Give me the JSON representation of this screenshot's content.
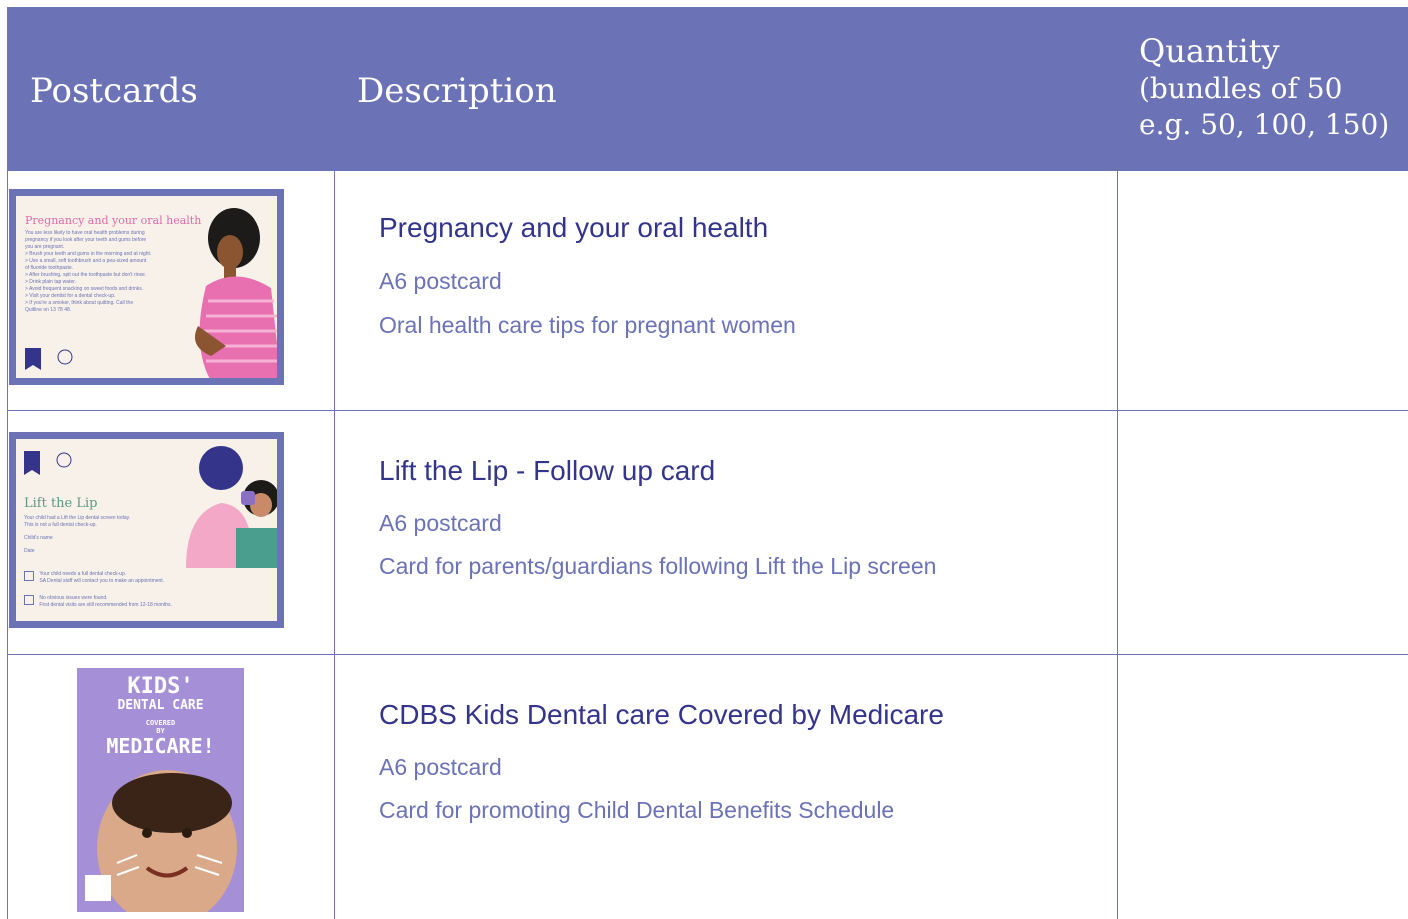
{
  "header": {
    "col1": "Postcards",
    "col2": "Description",
    "col3_title": "Quantity",
    "col3_sub_line1": "(bundles of 50",
    "col3_sub_line2": "e.g. 50, 100, 150)"
  },
  "rows": [
    {
      "title": "Pregnancy and your oral health",
      "format": "A6 postcard",
      "description": "Oral health care tips for pregnant women",
      "card": {
        "title": "Pregnancy and your oral health",
        "lines": [
          "You are less likely to have oral health problems during",
          "pregnancy if you look after your teeth and gums before",
          "you are pregnant.",
          "> Brush your teeth and gums in the morning and at night.",
          "> Use a small, soft toothbrush and a pea-sized amount",
          "of fluoride toothpaste.",
          "> After brushing, spit out the toothpaste but don't rinse.",
          "> Drink plain tap water.",
          "> Avoid frequent snacking on sweet foods and drinks.",
          "> Visit your dentist for a dental check-up.",
          "> If you're a smoker, think about quitting. Call the",
          "Quitline on 13 78 48."
        ],
        "logo": "SA Dental"
      }
    },
    {
      "title": "Lift the Lip - Follow up card",
      "format": "A6 postcard",
      "description": "Card for parents/guardians following Lift the Lip screen",
      "card": {
        "title": "Lift the Lip",
        "lines": [
          "Your child had a Lift the Lip dental screen today.",
          "This is not a full dental check-up.",
          "Child's name",
          "Date",
          "Your child needs a full dental check-up.",
          "SA Dental staff will contact you to make an appointment.",
          "No obvious issues were found.",
          "First dental visits are still recommended from 12-18 months."
        ],
        "logo": "SA Dental"
      }
    },
    {
      "title": "CDBS Kids Dental care Covered by Medicare",
      "format": "A6 postcard",
      "description": "Card for promoting Child Dental Benefits Schedule",
      "card": {
        "line1": "KIDS'",
        "line2": "DENTAL CARE",
        "line3": "COVERED",
        "line4": "BY",
        "line5": "MEDICARE!"
      }
    }
  ],
  "colors": {
    "header_bg": "#6b72b6",
    "title_text": "#33348a",
    "sub_text": "#6b72b6",
    "grid": "#6c73b8"
  }
}
